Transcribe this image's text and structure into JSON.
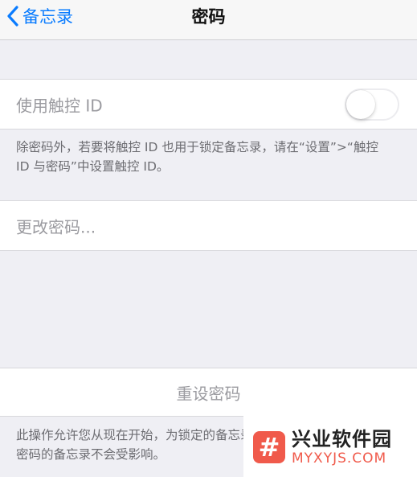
{
  "navbar": {
    "back_label": "备忘录",
    "title": "密码"
  },
  "touch_id": {
    "label": "使用触控 ID",
    "enabled": false,
    "note": "除密码外，若要将触控 ID 也用于锁定备忘录，请在“设置”>“触控 ID 与密码”中设置触控 ID。"
  },
  "change_password": {
    "label": "更改密码..."
  },
  "reset_password": {
    "label": "重设密码",
    "note": "此操作允许您从现在开始，为锁定的备忘录设置新密码。已使用旧有密码的备忘录不会受影响。"
  },
  "watermark": {
    "logo_char": "#",
    "name": "兴业软件园",
    "url": "MYXYJS.COM"
  },
  "colors": {
    "accent": "#0a7cff",
    "background": "#efeff4",
    "watermark_red": "#f05a4b"
  }
}
